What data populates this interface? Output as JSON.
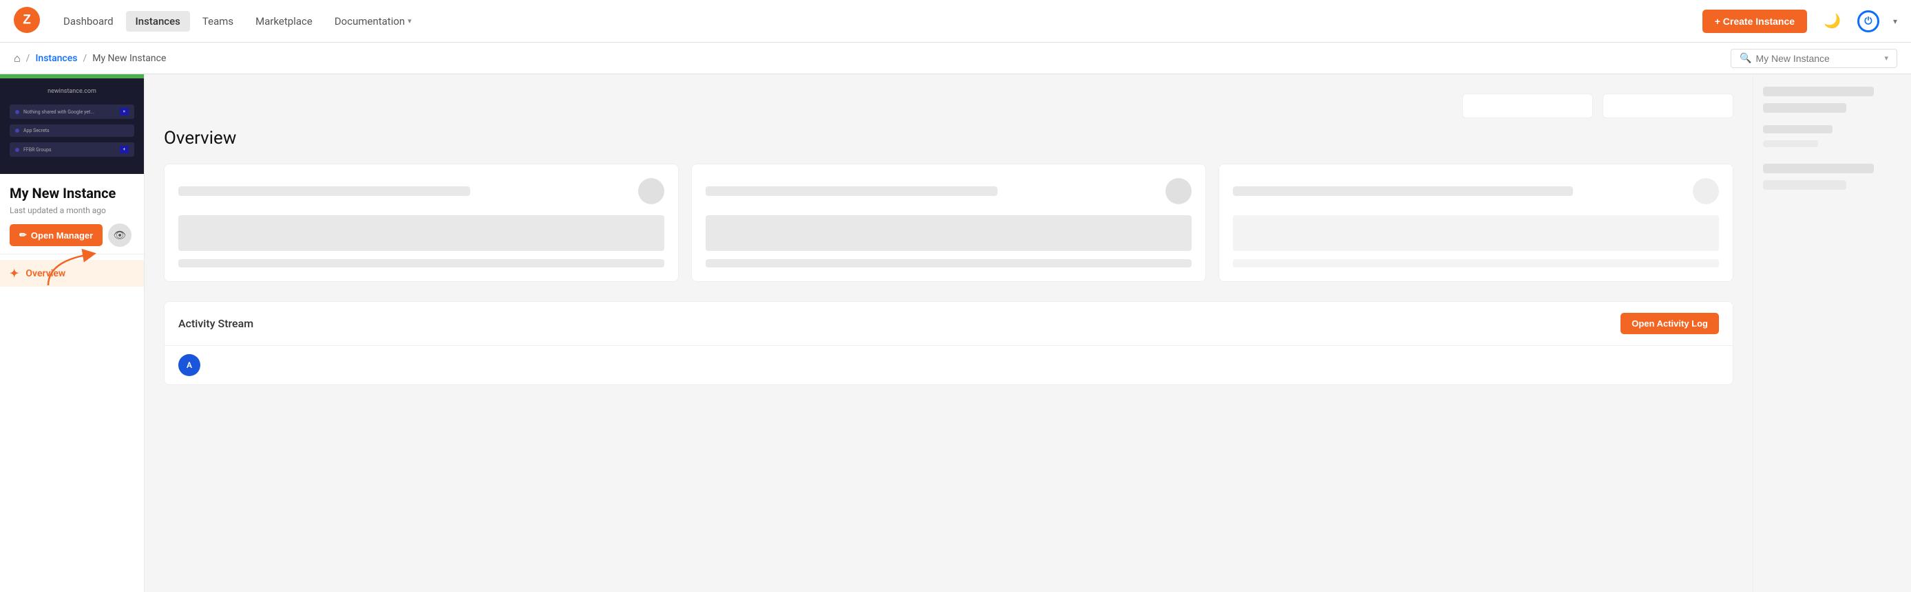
{
  "logo": {
    "alt": "Logo"
  },
  "nav": {
    "dashboard": "Dashboard",
    "instances": "Instances",
    "teams": "Teams",
    "marketplace": "Marketplace",
    "documentation": "Documentation",
    "create_instance": "+ Create Instance"
  },
  "breadcrumb": {
    "home_icon": "⌂",
    "instances": "Instances",
    "current": "My New Instance",
    "search_placeholder": "My New Instance"
  },
  "sidebar": {
    "instance_name": "My New Instance",
    "last_updated": "Last updated a month ago",
    "open_manager": "Open Manager",
    "overview_nav": "Overview"
  },
  "content": {
    "overview_title": "Overview",
    "activity_stream_title": "Activity Stream",
    "open_activity_log": "Open Activity Log"
  }
}
